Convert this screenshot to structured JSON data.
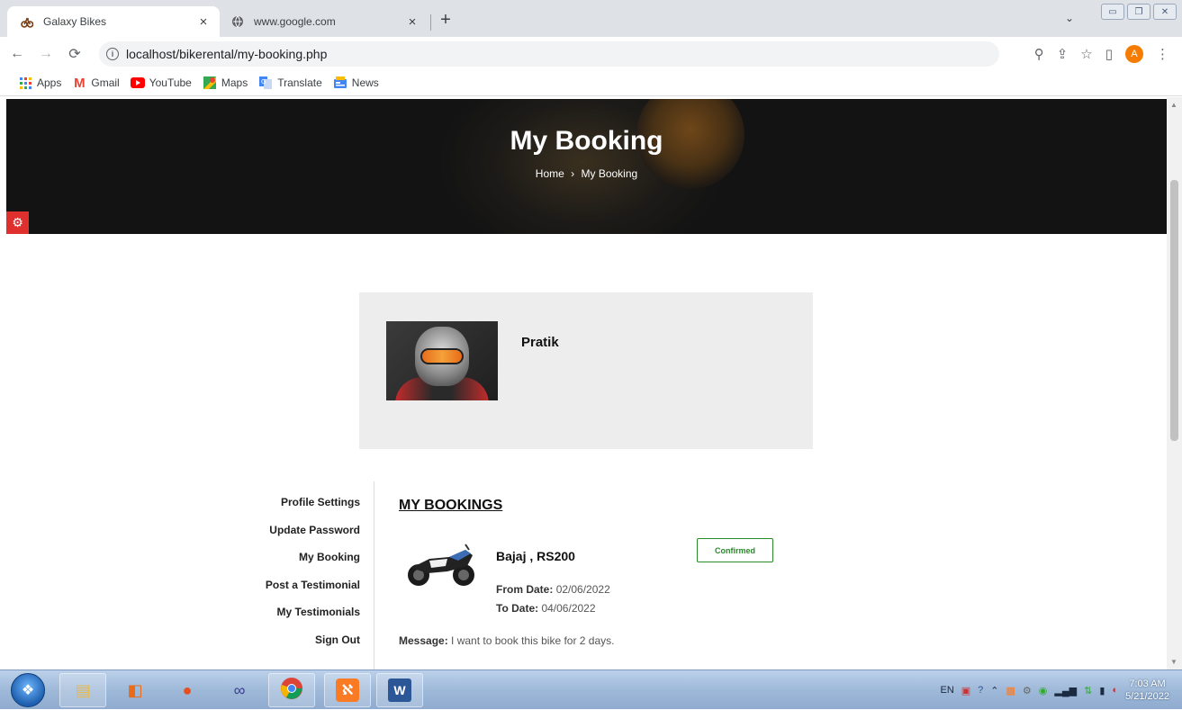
{
  "browser": {
    "tabs": [
      {
        "title": "Galaxy Bikes",
        "favicon": "bike-favicon-icon",
        "active": true
      },
      {
        "title": "www.google.com",
        "favicon": "globe-icon",
        "active": false
      }
    ],
    "url": "localhost/bikerental/my-booking.php",
    "profile_initial": "A",
    "bookmarks": [
      {
        "label": "Apps",
        "icon": "apps-grid-icon"
      },
      {
        "label": "Gmail",
        "icon": "gmail-icon"
      },
      {
        "label": "YouTube",
        "icon": "youtube-icon"
      },
      {
        "label": "Maps",
        "icon": "maps-icon"
      },
      {
        "label": "Translate",
        "icon": "translate-icon"
      },
      {
        "label": "News",
        "icon": "news-icon"
      }
    ]
  },
  "hero": {
    "title": "My Booking",
    "breadcrumb": {
      "home": "Home",
      "separator": "›",
      "current": "My Booking"
    }
  },
  "profile": {
    "name": "Pratik"
  },
  "sidebar": {
    "items": [
      {
        "label": "Profile Settings"
      },
      {
        "label": "Update Password"
      },
      {
        "label": "My Booking"
      },
      {
        "label": "Post a Testimonial"
      },
      {
        "label": "My Testimonials"
      },
      {
        "label": "Sign Out"
      }
    ]
  },
  "bookings": {
    "title": "MY BOOKINGS",
    "items": [
      {
        "bike": "Bajaj , RS200",
        "from_label": "From Date:",
        "from_date": "02/06/2022",
        "to_label": "To Date:",
        "to_date": "04/06/2022",
        "status": "Confirmed",
        "message_label": "Message:",
        "message": "I want to book this bike for 2 days."
      }
    ]
  },
  "taskbar": {
    "language": "EN",
    "time": "7:03 AM",
    "date": "5/21/2022"
  },
  "colors": {
    "accent_red": "#e0302e",
    "status_green": "#2a8a2a",
    "profile_bg": "#ededed"
  }
}
